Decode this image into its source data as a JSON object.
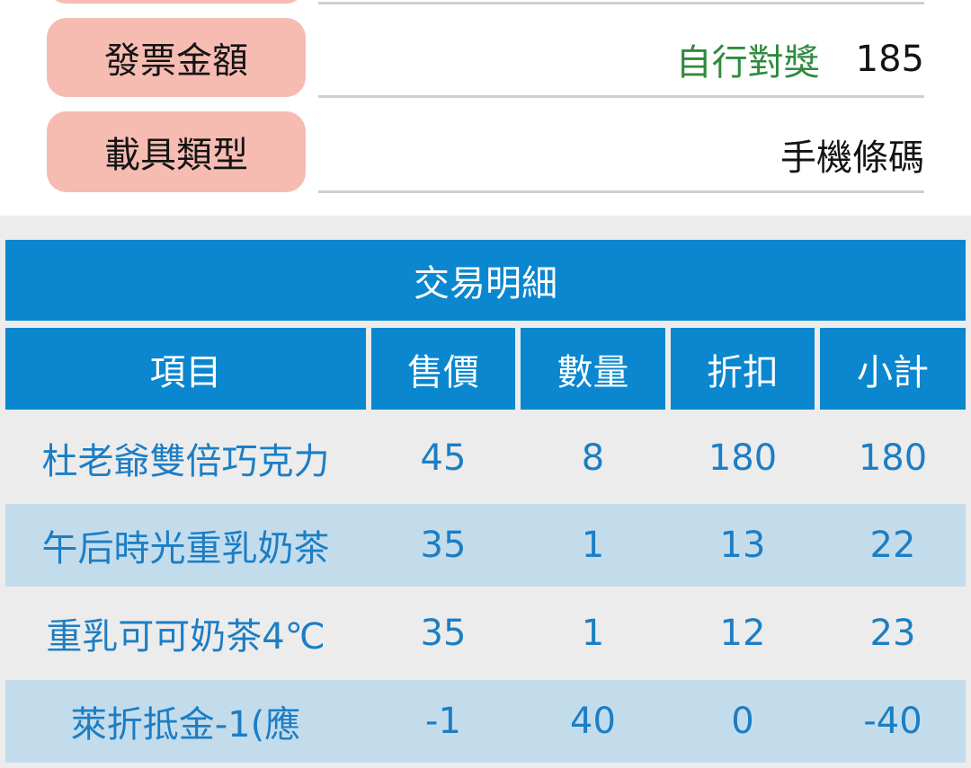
{
  "info": {
    "invoice_amount_label": "發票金額",
    "invoice_amount_status": "自行對獎",
    "invoice_amount_value": "185",
    "carrier_type_label": "載具類型",
    "carrier_type_value": "手機條碼"
  },
  "table": {
    "title": "交易明細",
    "headers": [
      "項目",
      "售價",
      "數量",
      "折扣",
      "小計"
    ],
    "rows": [
      [
        "杜老爺雙倍巧克力",
        "45",
        "8",
        "180",
        "180"
      ],
      [
        "午后時光重乳奶茶",
        "35",
        "1",
        "13",
        "22"
      ],
      [
        "重乳可可奶茶4℃",
        "35",
        "1",
        "12",
        "23"
      ],
      [
        "萊折抵金-1(應",
        "-1",
        "40",
        "0",
        "-40"
      ]
    ]
  },
  "colors": {
    "label_pill": "#f6bcb2",
    "status_green": "#2e8b3e",
    "header_blue": "#0a87cf",
    "cell_text_blue": "#1c7ec4",
    "row_alt": "#c3dcec",
    "row_bg": "#ececec"
  }
}
